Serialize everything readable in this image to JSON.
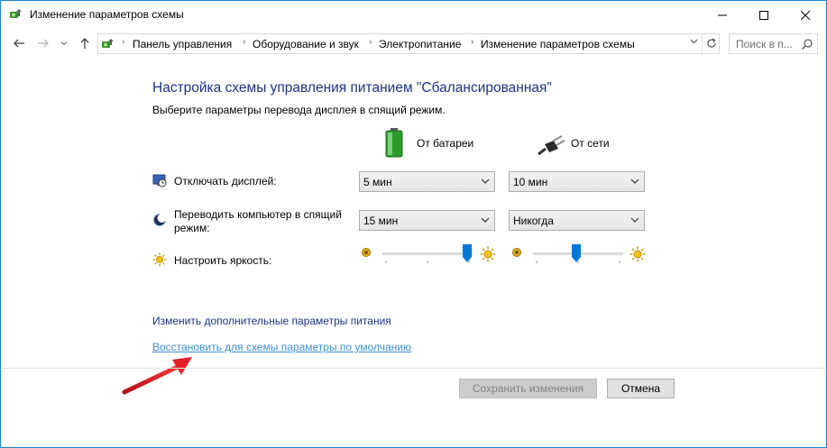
{
  "window": {
    "title": "Изменение параметров схемы",
    "controls": {
      "minimize": "—",
      "maximize": "☐",
      "close": "✕"
    }
  },
  "nav": {
    "back_icon": "arrow-left-icon",
    "forward_icon": "arrow-right-icon",
    "recent_icon": "chevron-down-icon",
    "up_icon": "arrow-up-icon",
    "breadcrumbs": [
      "Панель управления",
      "Оборудование и звук",
      "Электропитание",
      "Изменение параметров схемы"
    ],
    "search_placeholder": "Поиск в п..."
  },
  "content": {
    "heading": "Настройка схемы управления питанием \"Сбалансированная\"",
    "subtitle": "Выберите параметры перевода дисплея в спящий режим.",
    "columns": {
      "battery": "От батареи",
      "ac": "От сети"
    },
    "rows": {
      "display_off": {
        "label": "Отключать дисплей:",
        "battery": "5 мин",
        "ac": "10 мин"
      },
      "sleep": {
        "label_line1": "Переводить компьютер в спящий",
        "label_line2": "режим:",
        "battery": "15 мин",
        "ac": "Никогда"
      },
      "brightness": {
        "label": "Настроить яркость:",
        "battery_level": 1.0,
        "ac_level": 0.5
      }
    },
    "links": {
      "advanced": "Изменить дополнительные параметры питания",
      "restore": "Восстановить для схемы параметры по умолчанию"
    }
  },
  "footer": {
    "save": "Сохранить изменения",
    "cancel": "Отмена"
  },
  "colors": {
    "heading": "#1e3287",
    "link": "#1e3287",
    "link_restore": "#3d8fd1",
    "slider_thumb": "#0078d7",
    "annotation_arrow": "#e2202a"
  }
}
